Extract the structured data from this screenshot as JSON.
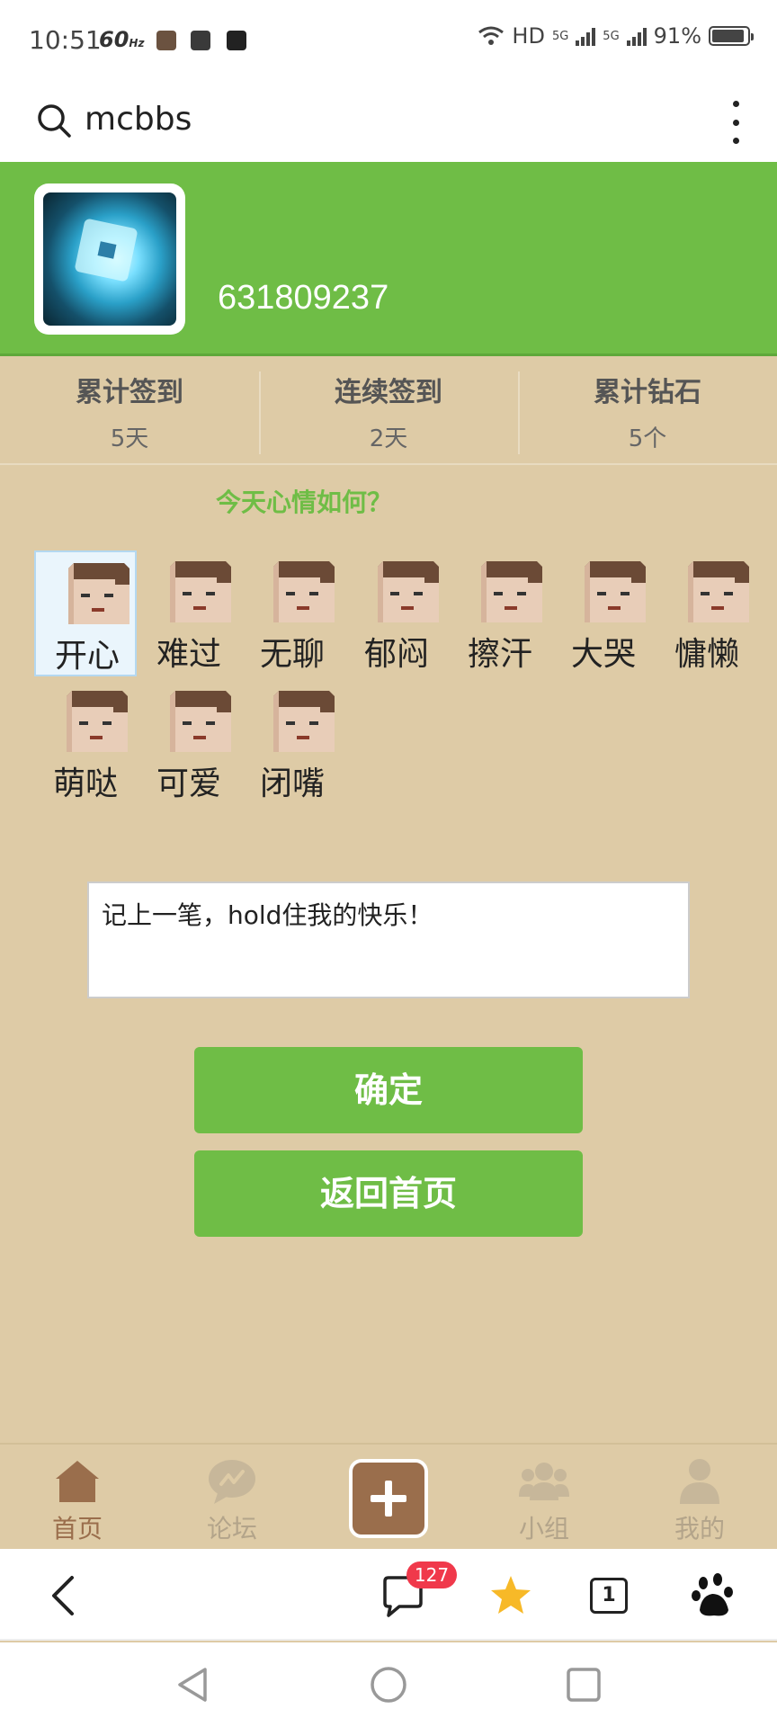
{
  "status": {
    "time": "10:51",
    "refresh": "60",
    "refresh_unit": "Hz",
    "network": "HD",
    "sim1": "5G",
    "sim2": "5G",
    "battery": "91%",
    "battery_level": 0.91
  },
  "search": {
    "query": "mcbbs"
  },
  "profile": {
    "user_id": "631809237"
  },
  "stats": [
    {
      "label": "累计签到",
      "value": "5天"
    },
    {
      "label": "连续签到",
      "value": "2天"
    },
    {
      "label": "累计钻石",
      "value": "5个"
    }
  ],
  "mood": {
    "question": "今天心情如何？",
    "selected": "开心",
    "options": [
      "开心",
      "难过",
      "无聊",
      "郁闷",
      "擦汗",
      "大哭",
      "慵懒",
      "萌哒",
      "可爱",
      "闭嘴"
    ]
  },
  "note": {
    "text": "记上一笔，hold住我的快乐！"
  },
  "buttons": {
    "confirm": "确定",
    "home": "返回首页"
  },
  "tabbar": {
    "home": "首页",
    "forum": "论坛",
    "group": "小组",
    "mine": "我的"
  },
  "browser": {
    "message_badge": "127",
    "tab_count": "1"
  },
  "colors": {
    "green": "#6fbd46",
    "tan": "#decba6",
    "brown": "#9a6e4c",
    "badge": "#f0394b"
  }
}
